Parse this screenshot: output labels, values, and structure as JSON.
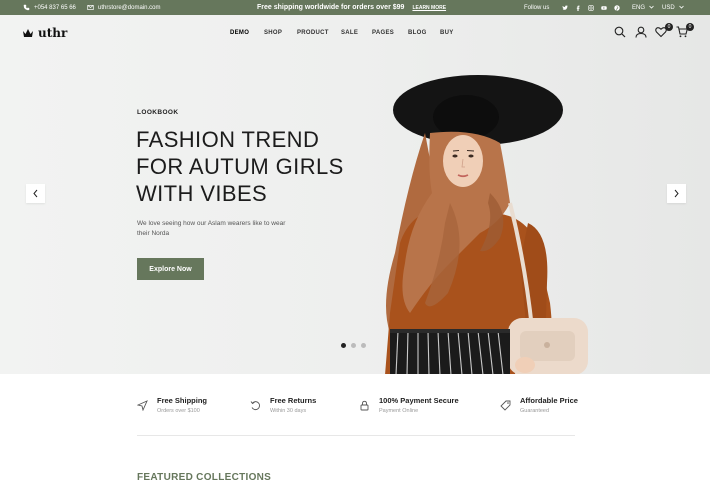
{
  "topbar": {
    "phone": "+054 837 65 66",
    "email": "uthrstore@domain.com",
    "promo": "Free shipping worldwide for orders over $99",
    "promo_link": "LEARN MORE",
    "follow_label": "Follow us",
    "language": "ENG",
    "currency": "USD"
  },
  "header": {
    "logo": "uthr",
    "nav": [
      "DEMO",
      "SHOP",
      "PRODUCT",
      "SALE",
      "PAGES",
      "BLOG",
      "BUY"
    ],
    "wishlist_count": "0",
    "cart_count": "0"
  },
  "hero": {
    "eyebrow": "LOOKBOOK",
    "title_lines": [
      "FASHION TREND",
      "FOR AUTUM GIRLS",
      "WITH VIBES"
    ],
    "text": "We love seeing how our Aslam wearers like to wear their Norda",
    "cta": "Explore Now",
    "slide_active": 1,
    "slide_count": 3
  },
  "features": [
    {
      "icon": "send-icon",
      "title": "Free Shipping",
      "subtitle": "Orders over $100"
    },
    {
      "icon": "return-icon",
      "title": "Free Returns",
      "subtitle": "Within 30 days"
    },
    {
      "icon": "lock-icon",
      "title": "100% Payment Secure",
      "subtitle": "Payment Online"
    },
    {
      "icon": "tag-icon",
      "title": "Affordable Price",
      "subtitle": "Guaranteed"
    }
  ],
  "section_title": "FEATURED COLLECTIONS",
  "colors": {
    "accent": "#66775c",
    "hero_bg": "#eeefee"
  }
}
